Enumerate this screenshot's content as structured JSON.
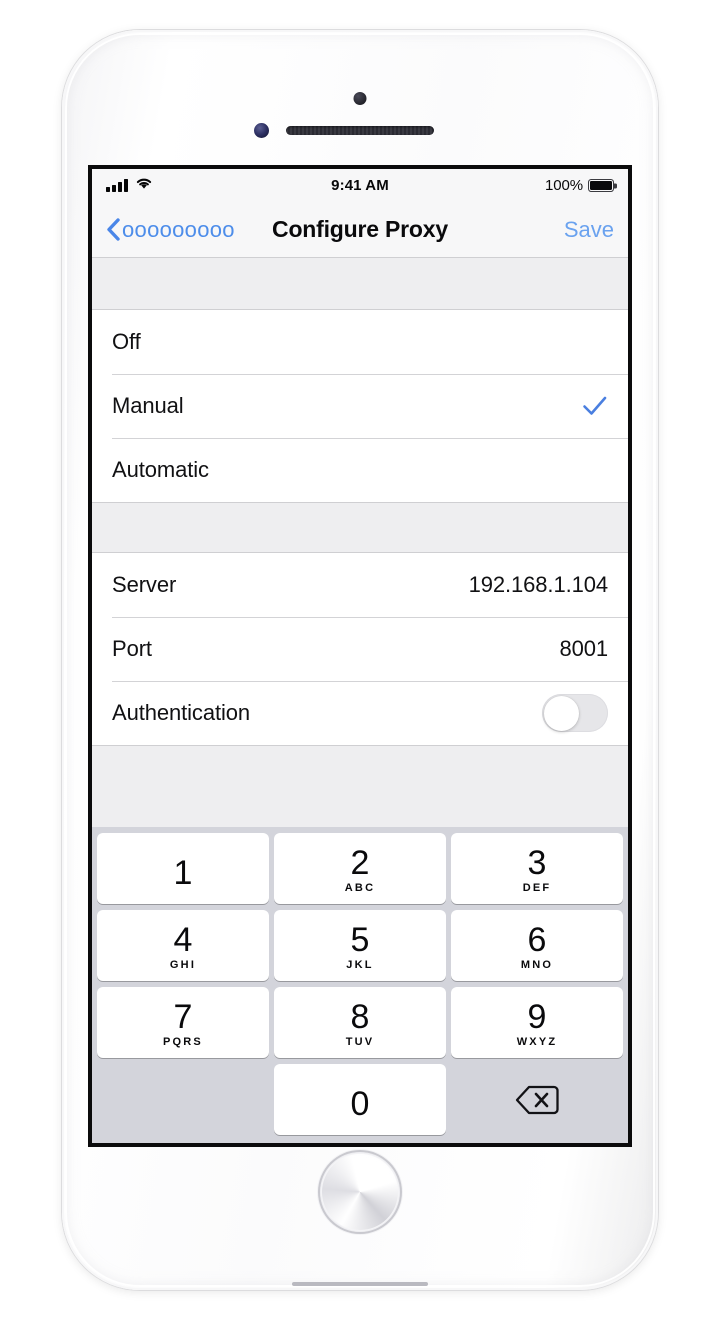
{
  "status_bar": {
    "signal_icon": "cellular-signal-icon",
    "wifi_icon": "wifi-icon",
    "time": "9:41 AM",
    "battery_percent": "100%",
    "battery_icon": "battery-full-icon"
  },
  "nav_bar": {
    "back_icon": "chevron-left-icon",
    "back_label": "ooooooooo",
    "title": "Configure Proxy",
    "save_label": "Save"
  },
  "proxy_mode_group": {
    "options": [
      {
        "label": "Off",
        "selected": false
      },
      {
        "label": "Manual",
        "selected": true
      },
      {
        "label": "Automatic",
        "selected": false
      }
    ],
    "checkmark_icon": "checkmark-icon",
    "checkmark_color": "#4a7fe0"
  },
  "proxy_settings_group": {
    "rows": [
      {
        "label": "Server",
        "value": "192.168.1.104"
      },
      {
        "label": "Port",
        "value": "8001"
      }
    ],
    "authentication": {
      "label": "Authentication",
      "toggle_state": "off",
      "toggle_icon": "toggle-switch-off-icon"
    }
  },
  "keypad": {
    "keys": [
      {
        "digit": "1",
        "letters": ""
      },
      {
        "digit": "2",
        "letters": "ABC"
      },
      {
        "digit": "3",
        "letters": "DEF"
      },
      {
        "digit": "4",
        "letters": "GHI"
      },
      {
        "digit": "5",
        "letters": "JKL"
      },
      {
        "digit": "6",
        "letters": "MNO"
      },
      {
        "digit": "7",
        "letters": "PQRS"
      },
      {
        "digit": "8",
        "letters": "TUV"
      },
      {
        "digit": "9",
        "letters": "WXYZ"
      },
      {
        "digit": "0",
        "letters": ""
      }
    ],
    "delete_icon": "backspace-delete-icon"
  },
  "device": {
    "home_button_icon": "home-button",
    "front_camera_icon": "front-camera",
    "earpiece_icon": "earpiece-speaker",
    "proximity_sensor_icon": "proximity-sensor"
  }
}
